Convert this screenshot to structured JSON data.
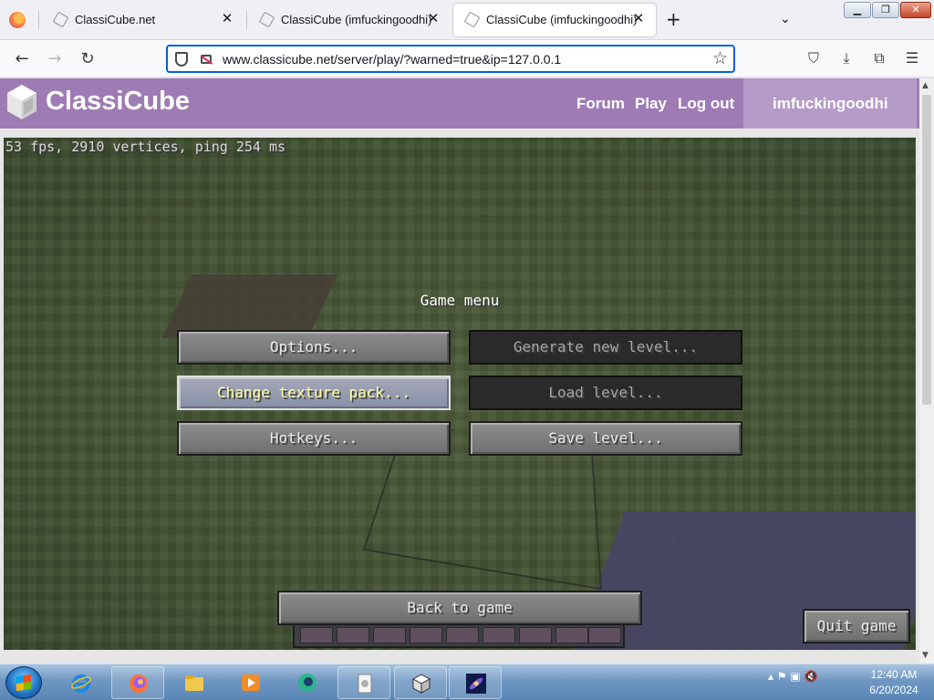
{
  "browser": {
    "tabs": [
      {
        "title": "ClassiCube.net",
        "active": false
      },
      {
        "title": "ClassiCube (imfuckingoodhi)",
        "active": false
      },
      {
        "title": "ClassiCube (imfuckingoodhi)",
        "active": true
      }
    ],
    "tab_close_glyph": "✕",
    "new_tab_glyph": "+",
    "tab_list_glyph": "⌄",
    "window_controls": {
      "minimize": "▁",
      "maximize": "❐",
      "close": "✕"
    },
    "url": "www.classicube.net/server/play/?warned=true&ip=127.0.0.1",
    "nav": {
      "back": "←",
      "forward": "→",
      "reload": "↻"
    },
    "star_glyph": "☆",
    "toolbar_icons": {
      "pocket": "⛉",
      "downloads": "⤓",
      "extensions": "⧉",
      "menu": "☰"
    }
  },
  "site": {
    "name": "ClassiCube",
    "links": [
      "Forum",
      "Play",
      "Log out"
    ],
    "username": "imfuckingoodhi",
    "header_color": "#9e7bb4"
  },
  "game": {
    "debug": "53 fps, 2910 vertices, ping 254 ms",
    "menu_title": "Game menu",
    "buttons": {
      "options": "Options...",
      "generate": "Generate new level...",
      "texture": "Change texture pack...",
      "load": "Load level...",
      "hotkeys": "Hotkeys...",
      "save": "Save level...",
      "back": "Back to game",
      "quit": "Quit game"
    }
  },
  "taskbar": {
    "time": "12:40 AM",
    "date": "6/20/2024",
    "tray": "▴ ⚑ ▣ 🔇"
  }
}
